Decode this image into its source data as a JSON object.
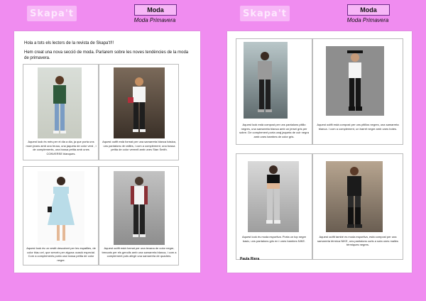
{
  "header": {
    "logo_text": "Skapa't",
    "section_label": "Moda",
    "section_subtitle": "Moda Primavera"
  },
  "page1": {
    "greeting": "Hola a tots els lectors de la revista de Skapa't!!!",
    "intro": "Hem creat una nova secció de moda. Parlarem sobre les noves tendències de la moda de primavera.",
    "captions": [
      "Aquest look és més per el dia a dia, ja que porta uns mom jeans amb una brusa, una jaqueta de color verd , i de complements, una bossa petita amb unes CONVERSE blanques.",
      "Aquest outfit està format per una samarreta blanca bàsica, uns pantalons de ratlles, i com a complement, una bossa petita de color vermell amb unes Stan Smith.",
      "Aquest look és un vestit descobert per les espatlles, de color blau cel, que serveix per alguna ocasió especial. Com a complements porta una bossa petita de color negre.",
      "Aquest outfit està format per una texana de color negre, trencats per els genolls amb una samarreta blanca, i com a complement pots afegir una samarreta de quadres."
    ]
  },
  "page2": {
    "captions": [
      "Aquest look està compost per uns pantalons pitillo negres, una samarreta blanca amb un jersei gris per sobre. De complement porta unaj jaqueta de cuir negra amb unes bambes de color gris.",
      "Aquest outfit està compost per uns pitillos negres, una samarreta blanca. I com a complement, un barret negre amb unes botes.",
      "Aquest look és moda esportiva. Porta un top negre basic, uns pantalons gris en i unes bambes NIKE.",
      "Aquest outfit també es moda esportiva, està compost per una samarreta tèrmica NIKE, uns pantalons curts a sota unes malles tèrmiques negres."
    ],
    "author": "Paula Riera"
  }
}
